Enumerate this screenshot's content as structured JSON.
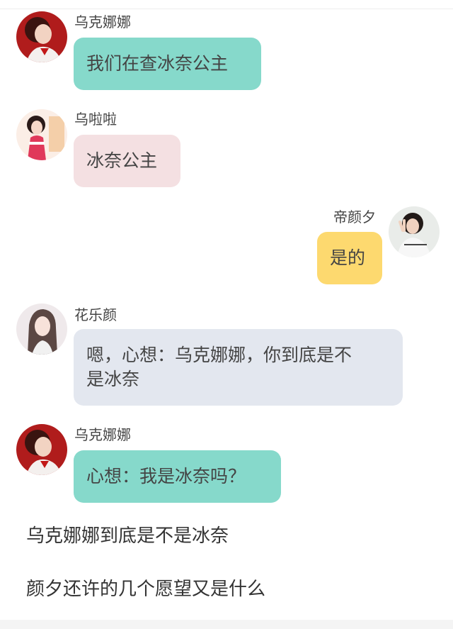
{
  "messages": [
    {
      "sender": "乌克娜娜",
      "text": "我们在查冰奈公主",
      "avatar_icon": "red-haired-girl-avatar",
      "bubble_color": "#86d9cb"
    },
    {
      "sender": "乌啦啦",
      "text": "冰奈公主",
      "avatar_icon": "pink-outfit-girl-avatar",
      "bubble_color": "#f4e0e2"
    },
    {
      "sender": "帝颜夕",
      "text": "是的",
      "avatar_icon": "peace-sign-girl-avatar",
      "bubble_color": "#fdd96f"
    },
    {
      "sender": "花乐颜",
      "text_line1": "嗯，心想：乌克娜娜，你到底是不",
      "text_line2": "是冰奈",
      "avatar_icon": "long-hair-girl-avatar",
      "bubble_color": "#e3e7ef"
    },
    {
      "sender": "乌克娜娜",
      "text": "心想：我是冰奈吗？",
      "avatar_icon": "red-haired-girl-avatar",
      "bubble_color": "#86d9cb"
    }
  ],
  "captions": [
    "乌克娜娜到底是不是冰奈",
    "颜夕还许的几个愿望又是什么"
  ]
}
